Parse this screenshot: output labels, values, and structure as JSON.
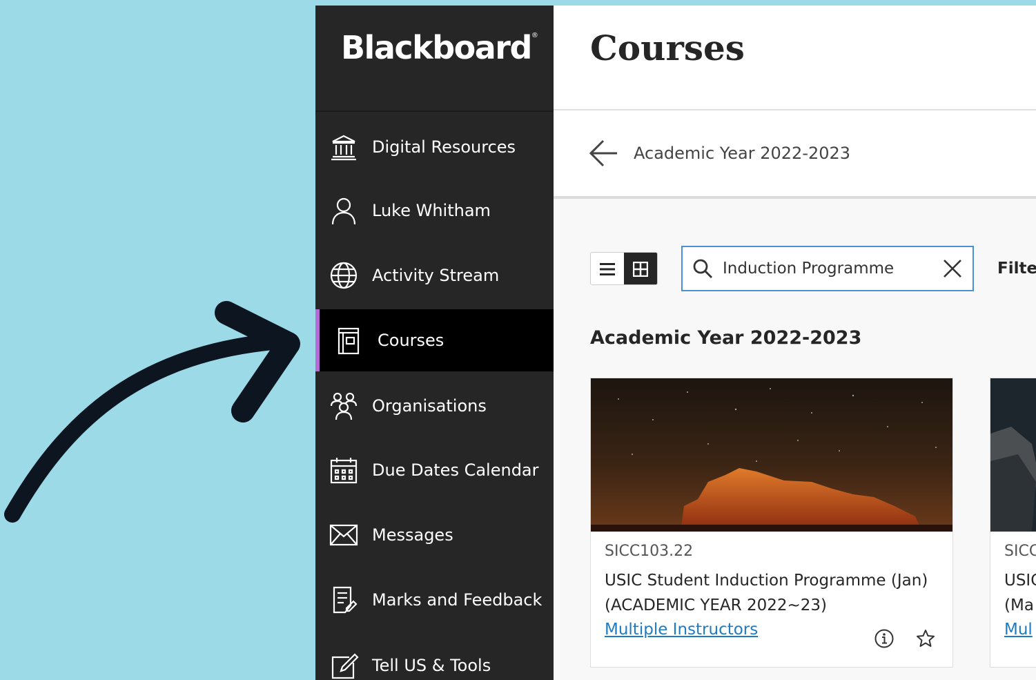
{
  "sidebar": {
    "logo": "Blackboard",
    "items": [
      {
        "label": "Digital Resources",
        "icon": "institution-icon"
      },
      {
        "label": "Luke Whitham",
        "icon": "user-icon"
      },
      {
        "label": "Activity Stream",
        "icon": "globe-icon"
      },
      {
        "label": "Courses",
        "icon": "courses-icon",
        "active": true
      },
      {
        "label": "Organisations",
        "icon": "organisations-icon"
      },
      {
        "label": "Due Dates Calendar",
        "icon": "calendar-icon"
      },
      {
        "label": "Messages",
        "icon": "envelope-icon"
      },
      {
        "label": "Marks and Feedback",
        "icon": "grades-icon"
      },
      {
        "label": "Tell US & Tools",
        "icon": "tools-icon"
      }
    ],
    "active_accent": "#b66ad6"
  },
  "header": {
    "title": "Courses"
  },
  "breadcrumb": {
    "label": "Academic Year 2022-2023"
  },
  "toolbar": {
    "search_value": "Induction Programme",
    "filter_label": "Filter"
  },
  "section": {
    "title": "Academic Year 2022-2023"
  },
  "cards": [
    {
      "id": "SICC103.22",
      "name_line1": "USIC Student Induction Programme (Jan)",
      "name_line2": "(ACADEMIC YEAR 2022~23)",
      "instructors": "Multiple Instructors"
    },
    {
      "id": "SICC",
      "name_line1": "USIC",
      "name_line2": "(Ma",
      "instructors": "Mul"
    }
  ],
  "colors": {
    "background": "#9bdae6",
    "sidebar": "#262626",
    "link": "#1f7bc1",
    "search_border": "#4a90d9"
  }
}
